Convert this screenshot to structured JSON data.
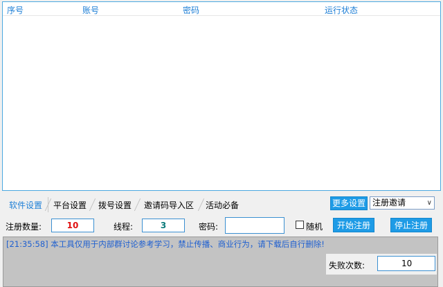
{
  "table": {
    "columns": [
      "序号",
      "账号",
      "密码",
      "运行状态"
    ]
  },
  "tabs": [
    "软件设置",
    "平台设置",
    "拨号设置",
    "邀请码导入区",
    "活动必备"
  ],
  "more_settings_button": "更多设置",
  "mode_select": {
    "value": "注册邀请"
  },
  "form": {
    "register_count_label": "注册数量:",
    "register_count_value": "10",
    "threads_label": "线程:",
    "threads_value": "3",
    "password_label": "密码:",
    "password_value": "",
    "random_label": "随机",
    "start_button": "开始注册",
    "stop_button": "停止注册"
  },
  "log": {
    "line": "[21:35:58] 本工具仅用于内部群讨论参考学习，禁止传播、商业行为，请下载后自行删除!"
  },
  "fail_count": {
    "label": "失败次数:",
    "value": "10"
  },
  "colors": {
    "accent": "#1e9be6",
    "register_count_text": "#e01010",
    "threads_text": "#0a7a7a",
    "log_text": "#1e5fd0"
  }
}
